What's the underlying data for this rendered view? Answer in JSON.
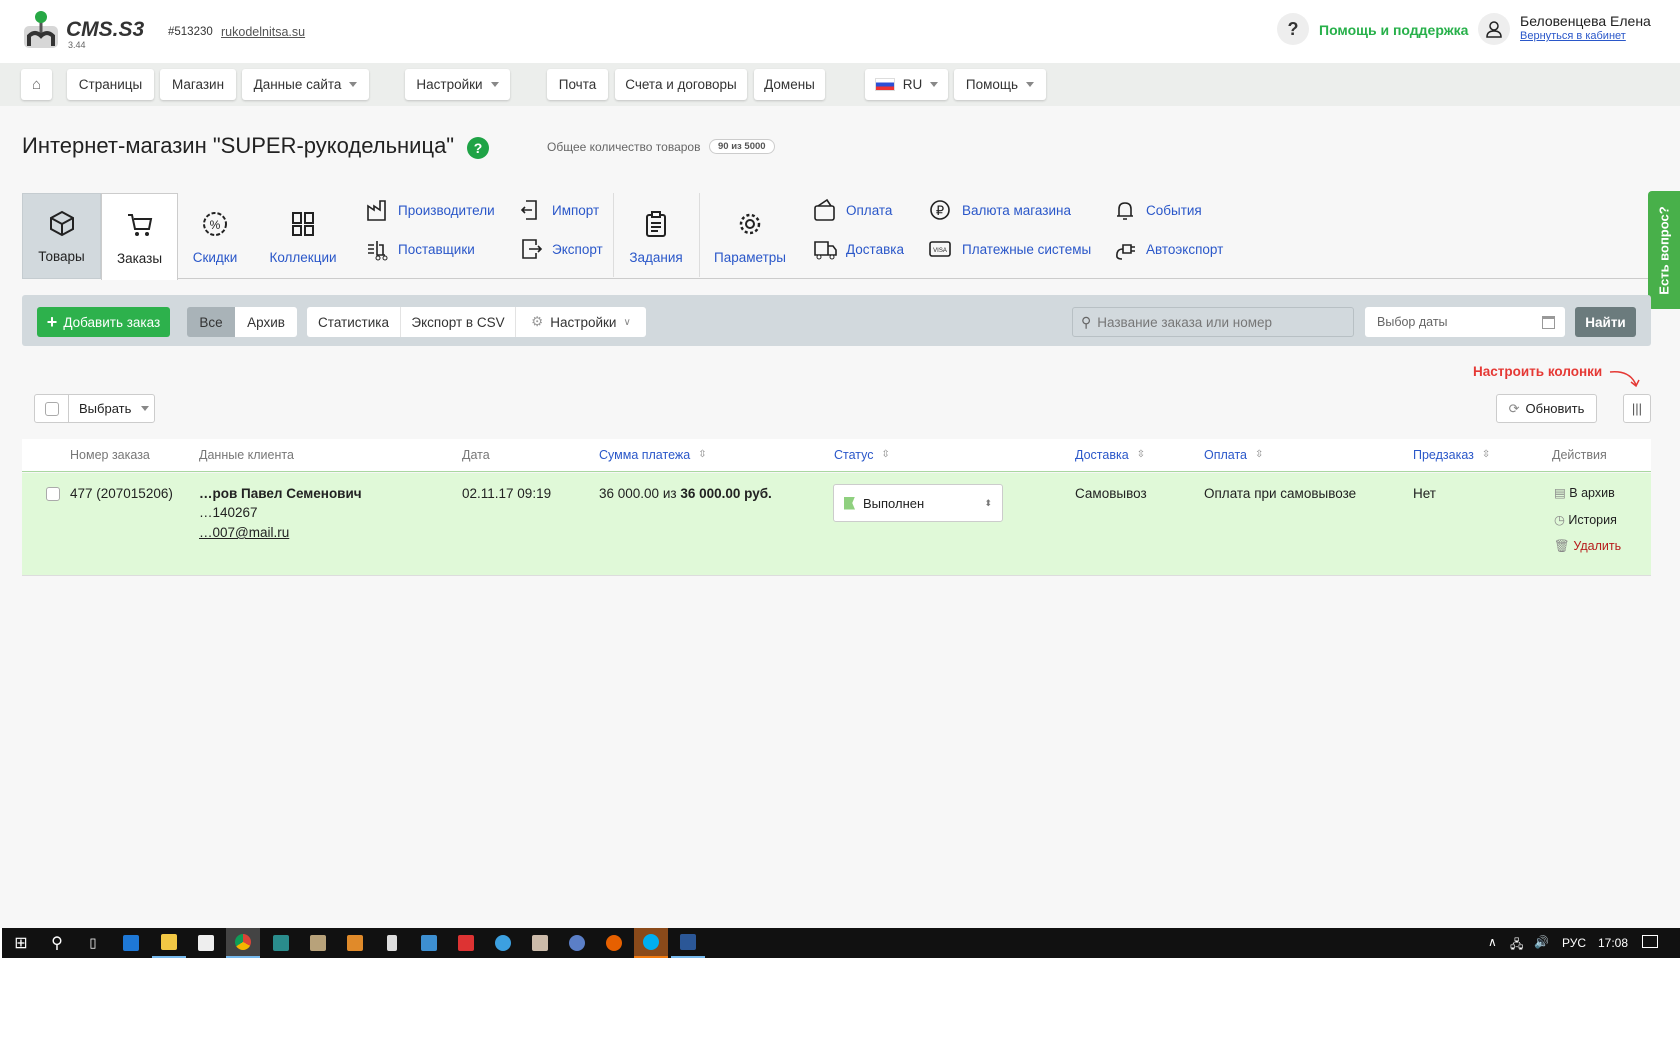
{
  "header": {
    "logo_text": "CMS.S3",
    "version": "3.44",
    "site_id": "#513230",
    "site_domain": "rukodelnitsa.su",
    "help_label": "Помощь и поддержка",
    "user_name": "Беловенцева Елена",
    "back_link": "Вернуться в кабинет"
  },
  "nav": {
    "items": [
      "Страницы",
      "Магазин",
      "Данные сайта",
      "Настройки",
      "Почта",
      "Счета и договоры",
      "Домены",
      "RU",
      "Помощь"
    ]
  },
  "page": {
    "title": "Интернет-магазин \"SUPER-рукодельница\"",
    "help_badge": "?",
    "count_label": "Общее количество товаров",
    "count_value": "90 из 5000"
  },
  "modules": {
    "tovary": "Товары",
    "zakazy": "Заказы",
    "skidki": "Скидки",
    "kollekcii": "Коллекции",
    "proizvoditeli": "Производители",
    "postavshiki": "Поставщики",
    "import": "Импорт",
    "export": "Экспорт",
    "zadaniya": "Задания",
    "parametry": "Параметры",
    "oplata": "Оплата",
    "dostavka": "Доставка",
    "valuta": "Валюта магазина",
    "platezhnye": "Платежные системы",
    "sobytiya": "События",
    "avtoexport": "Автоэкспорт"
  },
  "side_tab": "Есть вопрос?",
  "toolbar": {
    "add_order": "Добавить заказ",
    "all": "Все",
    "archive": "Архив",
    "stats": "Статистика",
    "export_csv": "Экспорт в CSV",
    "settings": "Настройки",
    "search_placeholder": "Название заказа или номер",
    "date_placeholder": "Выбор даты",
    "find": "Найти"
  },
  "list": {
    "select": "Выбрать",
    "refresh": "Обновить",
    "configure_columns": "Настроить колонки"
  },
  "table": {
    "headers": [
      "Номер заказа",
      "Данные клиента",
      "Дата",
      "Сумма платежа",
      "Статус",
      "Доставка",
      "Оплата",
      "Предзаказ",
      "Действия"
    ],
    "rows": [
      {
        "number": "477 (207015206)",
        "client_name": "…ров Павел Семенович",
        "client_phone": "…140267",
        "client_email": "…007@mail.ru",
        "date": "02.11.17 09:19",
        "sum_paid": "36 000.00",
        "sum_of": "из",
        "sum_total": "36 000.00 руб.",
        "status": "Выполнен",
        "delivery": "Самовывоз",
        "payment": "Оплата при самовывозе",
        "preorder": "Нет",
        "actions": [
          "В архив",
          "История",
          "Удалить"
        ]
      }
    ]
  },
  "taskbar": {
    "lang": "РУС",
    "time": "17:08"
  },
  "colors": {
    "accent": "#2a57c9",
    "green": "#27b04a",
    "row_bg": "#e0f9d8",
    "danger": "#e53935"
  }
}
